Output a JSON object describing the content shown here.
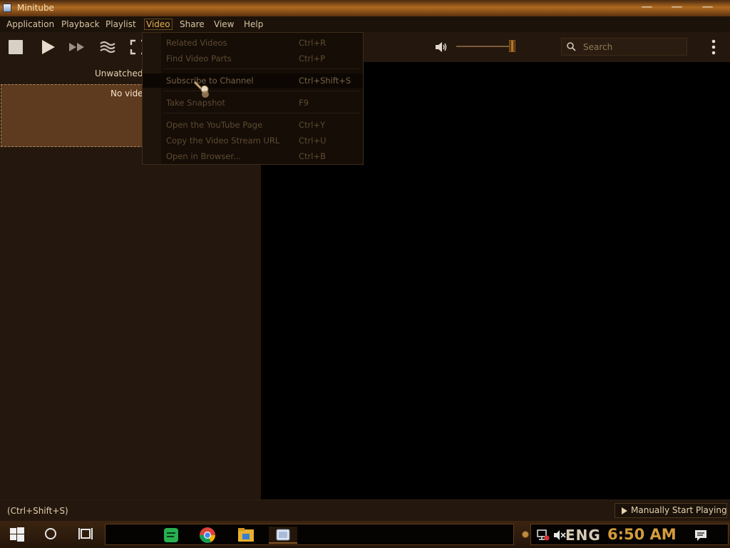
{
  "window": {
    "title": "Minitube",
    "controls": [
      "minimize",
      "maximize",
      "close"
    ]
  },
  "menubar": {
    "items": [
      {
        "label": "Application"
      },
      {
        "label": "Playback"
      },
      {
        "label": "Playlist"
      },
      {
        "label": "Video"
      },
      {
        "label": "Share"
      },
      {
        "label": "View"
      },
      {
        "label": "Help"
      }
    ],
    "active": "Video"
  },
  "toolbar": {
    "icons": [
      "stop-icon",
      "play-icon",
      "skip-icon",
      "related-icon",
      "fullscreen-icon",
      "volume-icon",
      "search-icon",
      "kebab-menu-icon"
    ],
    "search_placeholder": "Search",
    "volume_level": 0.95
  },
  "left_panel": {
    "unwatched_label": "Unwatched '",
    "no_video_text": "No vide"
  },
  "video_menu": {
    "items": [
      {
        "label": "Related Videos",
        "shortcut": "Ctrl+R",
        "enabled": false
      },
      {
        "label": "Find Video Parts",
        "shortcut": "Ctrl+P",
        "enabled": false
      },
      {
        "label": "Subscribe to Channel",
        "shortcut": "Ctrl+Shift+S",
        "enabled": false,
        "highlighted": true
      },
      {
        "label": "Take Snapshot",
        "shortcut": "F9",
        "enabled": false
      },
      {
        "label": "Open the YouTube Page",
        "shortcut": "Ctrl+Y",
        "enabled": false
      },
      {
        "label": "Copy the Video Stream URL",
        "shortcut": "Ctrl+U",
        "enabled": false
      },
      {
        "label": "Open in Browser...",
        "shortcut": "Ctrl+B",
        "enabled": false
      }
    ]
  },
  "statusbar": {
    "text": "(Ctrl+Shift+S)",
    "manual_button": "Manually Start Playing"
  },
  "taskbar": {
    "pinned": [
      "start-icon",
      "search-icon",
      "task-view-icon"
    ],
    "apps": [
      "notes-app-icon",
      "chrome-icon",
      "file-explorer-icon",
      "minitube-icon"
    ],
    "tray": {
      "language": "ENG",
      "time": "6:50 AM"
    }
  },
  "colors": {
    "accent": "#e8b050",
    "window_bg": "#24170d",
    "menu_bg": "#150d06",
    "disabled_text": "#5e4a32",
    "clock": "#d49c3c"
  }
}
